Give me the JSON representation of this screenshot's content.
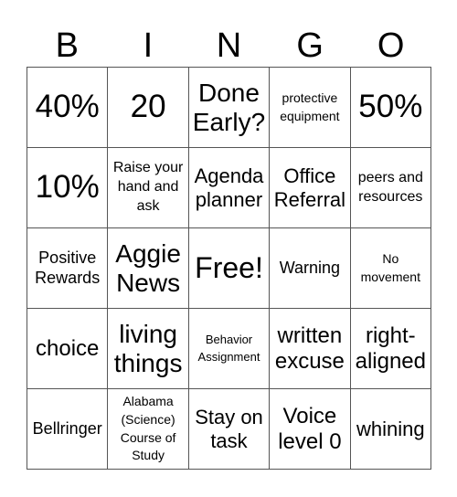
{
  "header": [
    "B",
    "I",
    "N",
    "G",
    "O"
  ],
  "cells": [
    [
      "40%",
      "20",
      "Done Early?",
      "protective equipment",
      "50%"
    ],
    [
      "10%",
      "Raise your hand and ask",
      "Agenda planner",
      "Office Referral",
      "peers and resources"
    ],
    [
      "Positive Rewards",
      "Aggie News",
      "Free!",
      "Warning",
      "No movement"
    ],
    [
      "choice",
      "living things",
      "Behavior Assignment",
      "written excuse",
      "right-aligned"
    ],
    [
      "Bellringer",
      "Alabama (Science) Course of Study",
      "Stay on task",
      "Voice level 0",
      "whining"
    ]
  ]
}
